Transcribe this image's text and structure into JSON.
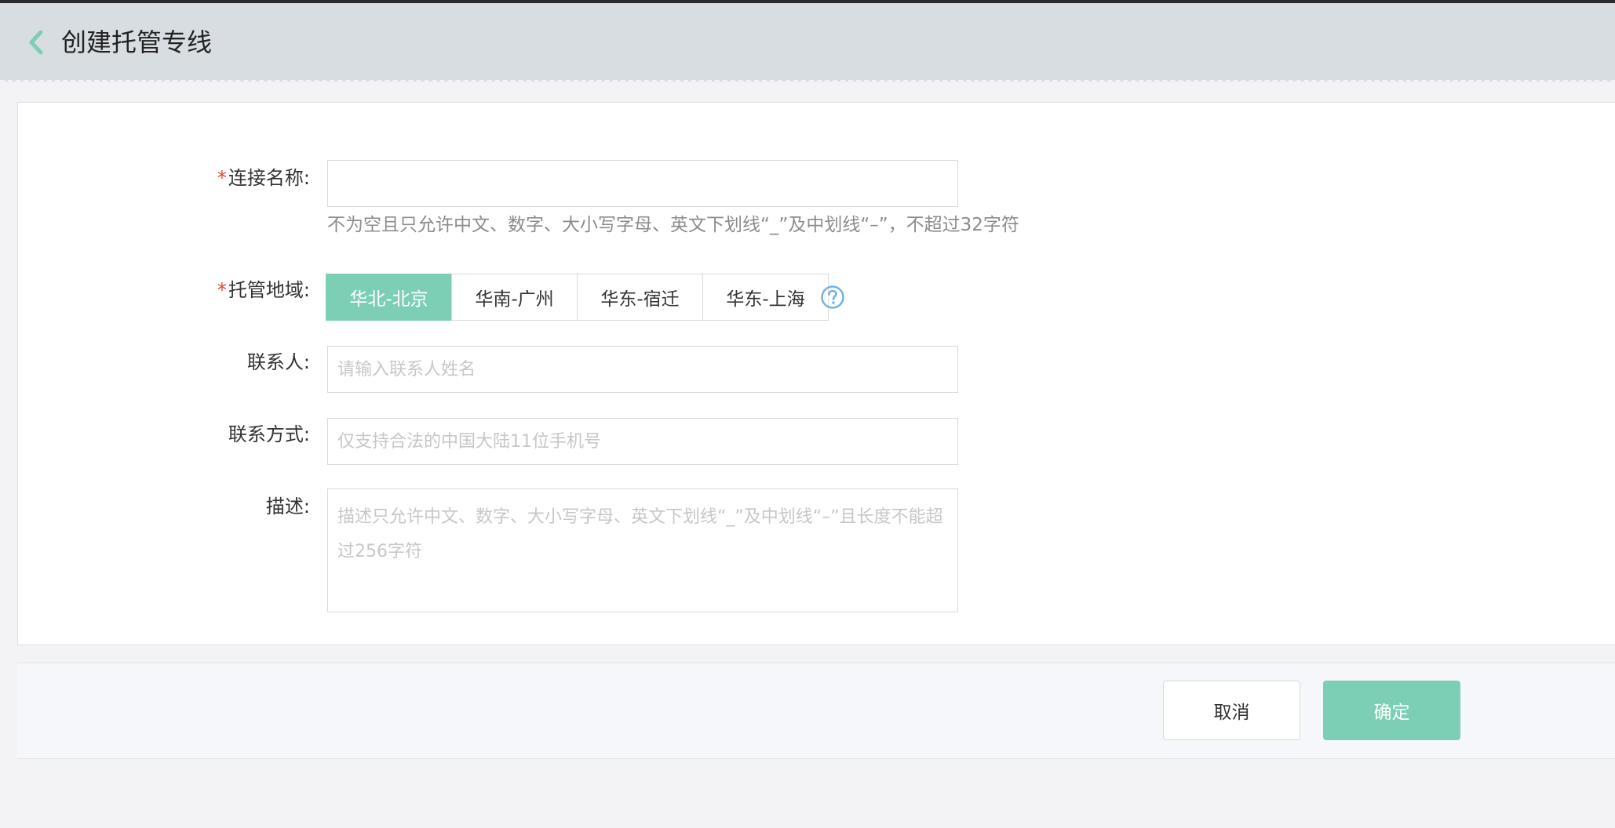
{
  "header": {
    "title": "创建托管专线",
    "back_icon": "chevron-left-icon"
  },
  "form": {
    "name": {
      "required_mark": "*",
      "label": "连接名称:",
      "value": "",
      "hint": "不为空且只允许中文、数字、大小写字母、英文下划线“_”及中划线“–”，不超过32字符"
    },
    "region": {
      "required_mark": "*",
      "label": "托管地域:",
      "options": [
        "华北-北京",
        "华南-广州",
        "华东-宿迁",
        "华东-上海"
      ],
      "selected": "华北-北京",
      "help_icon": "question-circle-icon"
    },
    "contact": {
      "label": "联系人:",
      "placeholder": "请输入联系人姓名"
    },
    "phone": {
      "label": "联系方式:",
      "placeholder": "仅支持合法的中国大陆11位手机号"
    },
    "description": {
      "label": "描述:",
      "placeholder": "描述只允许中文、数字、大小写字母、英文下划线“_”及中划线“–”且长度不能超过256字符"
    }
  },
  "footer": {
    "cancel_label": "取消",
    "confirm_label": "确定"
  },
  "colors": {
    "accent": "#7ccfb5",
    "required": "#e0433c",
    "help": "#6fb2ea"
  }
}
